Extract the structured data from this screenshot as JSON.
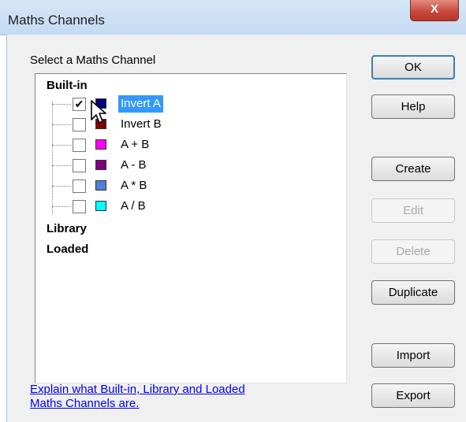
{
  "window": {
    "title": "Maths Channels",
    "close_glyph": "X"
  },
  "group_label": "Select a Maths Channel",
  "tree": {
    "categories": [
      "Built-in",
      "Library",
      "Loaded"
    ],
    "items": [
      {
        "label": "Invert A",
        "checked": true,
        "color": "#00007f",
        "selected": true
      },
      {
        "label": "Invert B",
        "checked": false,
        "color": "#7f0000",
        "selected": false
      },
      {
        "label": "A + B",
        "checked": false,
        "color": "#ff00ff",
        "selected": false
      },
      {
        "label": "A - B",
        "checked": false,
        "color": "#7f007f",
        "selected": false
      },
      {
        "label": "A * B",
        "checked": false,
        "color": "#4f81d9",
        "selected": false
      },
      {
        "label": "A / B",
        "checked": false,
        "color": "#00ffff",
        "selected": false
      }
    ]
  },
  "check_glyph": "✔",
  "help_link": {
    "line1": "Explain what Built-in, Library and Loaded",
    "line2": "Maths Channels are."
  },
  "buttons": {
    "ok": "OK",
    "help": "Help",
    "create": "Create",
    "edit": "Edit",
    "delete": "Delete",
    "duplicate": "Duplicate",
    "import": "Import",
    "export": "Export"
  },
  "colors": {
    "selection": "#3399ff",
    "link": "#0000ee",
    "close_button": "#c7473a"
  }
}
